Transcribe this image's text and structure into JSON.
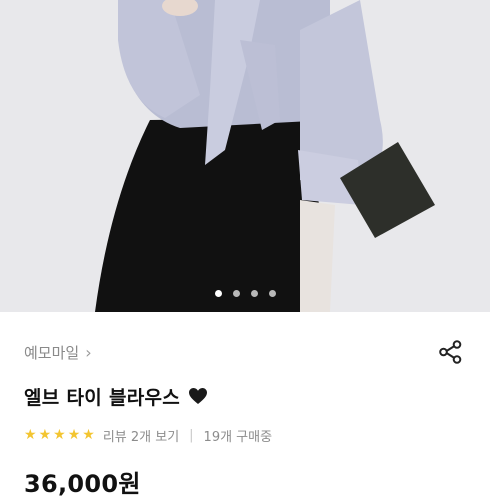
{
  "carousel": {
    "page_count": 4,
    "active_index": 0
  },
  "shop": {
    "name": "예모마일",
    "chevron": "›"
  },
  "share": {
    "icon": "share-icon"
  },
  "product": {
    "title": "엘브 타이 블라우스",
    "title_icon": "heart-icon",
    "rating": 5,
    "reviews_label": "리뷰 2개 보기",
    "separator": "|",
    "purchases_label": "19개 구매중",
    "price": "36,000원"
  },
  "colors": {
    "star": "#f3c531",
    "text": "#111111",
    "muted": "#8c8c8c"
  }
}
